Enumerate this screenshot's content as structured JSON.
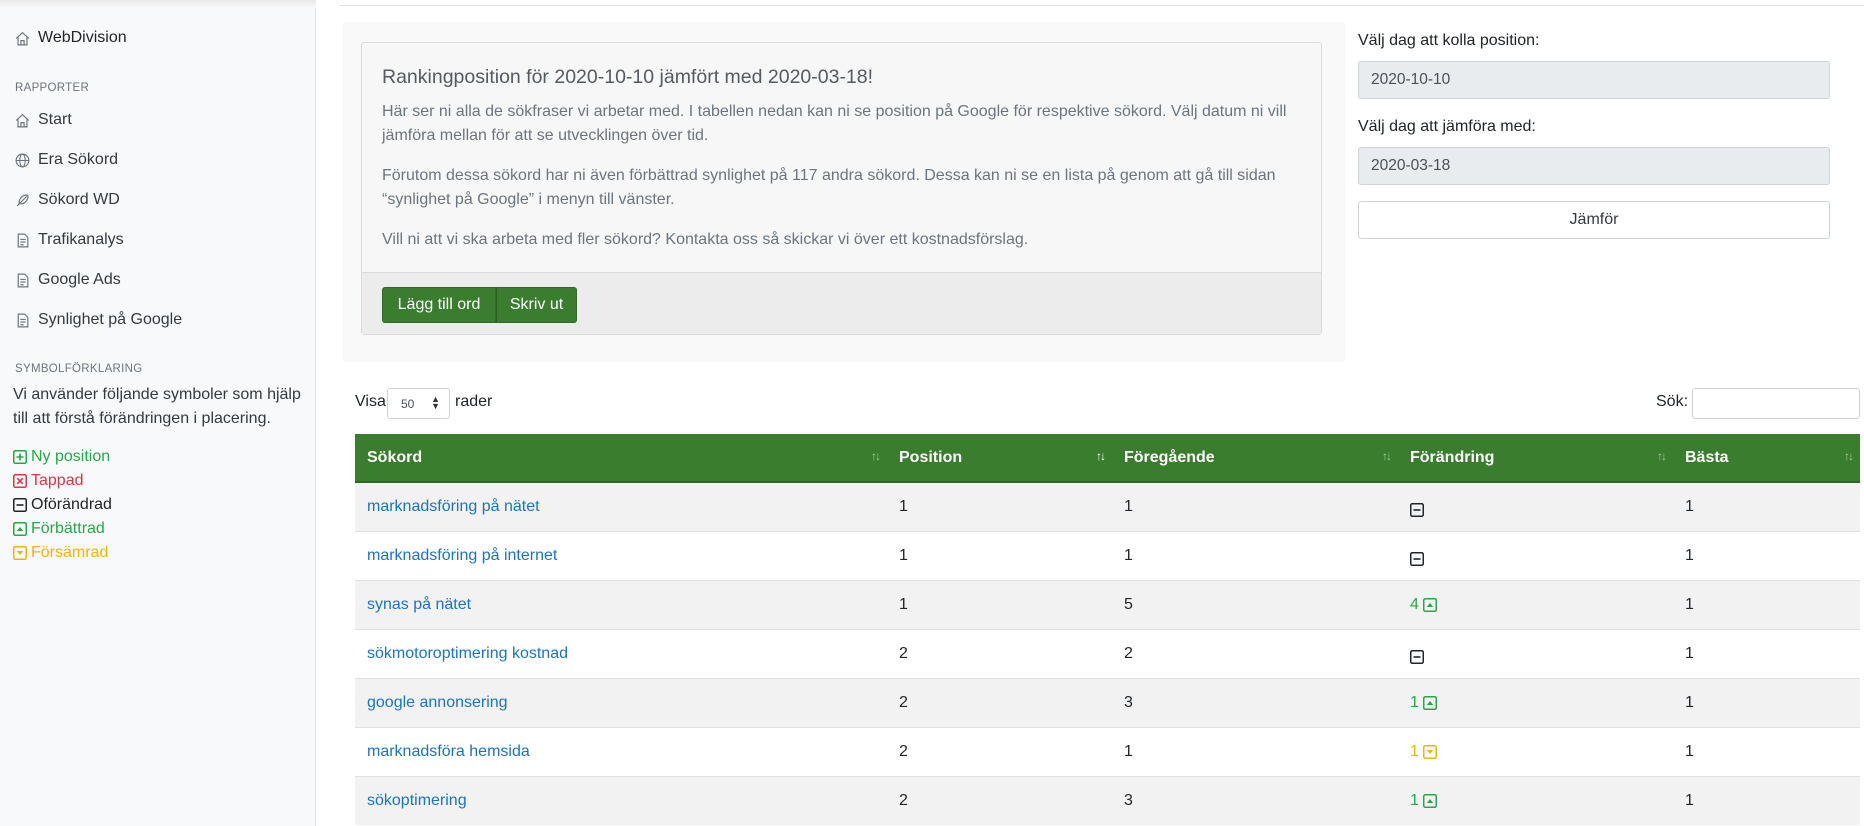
{
  "sidebar": {
    "brand": "WebDivision",
    "reports_heading": "RAPPORTER",
    "items": [
      {
        "label": "Start",
        "icon": "home-icon"
      },
      {
        "label": "Era Sökord",
        "icon": "globe-icon"
      },
      {
        "label": "Sökord WD",
        "icon": "feather-icon"
      },
      {
        "label": "Trafikanalys",
        "icon": "document-icon"
      },
      {
        "label": "Google Ads",
        "icon": "document-icon"
      },
      {
        "label": "Synlighet på Google",
        "icon": "document-icon"
      }
    ],
    "legend_heading": "SYMBOLFÖRKLARING",
    "legend_description": "Vi använder följande symboler som hjälp till att förstå förändringen i placering.",
    "legend": [
      {
        "label": "Ny position",
        "color": "#28a745",
        "icon": "plus-square-icon"
      },
      {
        "label": "Tappad",
        "color": "#dc3545",
        "icon": "x-square-icon"
      },
      {
        "label": "Oförändrad",
        "color": "#212529",
        "icon": "minus-square-icon"
      },
      {
        "label": "Förbättrad",
        "color": "#28a745",
        "icon": "caret-up-square-icon"
      },
      {
        "label": "Försämrad",
        "color": "#f3b307",
        "icon": "caret-down-square-icon"
      }
    ]
  },
  "info": {
    "title": "Rankingposition för 2020-10-10 jämfört med 2020-03-18!",
    "paragraphs": [
      "Här ser ni alla de sökfraser vi arbetar med. I tabellen nedan kan ni se position på Google för respektive sökord. Välj datum ni vill jämföra mellan för att se utvecklingen över tid.",
      "Förutom dessa sökord har ni även förbättrad synlighet på 117 andra sökord. Dessa kan ni se en lista på genom att gå till sidan “synlighet på Google” i menyn till vänster.",
      "Vill ni att vi ska arbeta med fler sökord? Kontakta oss så skickar vi över ett kostnadsförslag."
    ],
    "add_button": "Lägg till ord",
    "print_button": "Skriv ut"
  },
  "dates": {
    "position_label": "Välj dag att kolla position:",
    "position_value": "2020-10-10",
    "compare_label": "Välj dag att jämföra med:",
    "compare_value": "2020-03-18",
    "compare_button": "Jämför"
  },
  "table_controls": {
    "show_prefix": "Visa",
    "page_size": "50",
    "show_suffix": "rader",
    "search_label": "Sök:"
  },
  "table": {
    "columns": [
      "Sökord",
      "Position",
      "Föregående",
      "Förändring",
      "Bästa"
    ],
    "sorted_column": "Position",
    "rows": [
      {
        "keyword": "marknadsföring på nätet",
        "position": "1",
        "previous": "1",
        "change": "",
        "change_type": "unchanged",
        "best": "1"
      },
      {
        "keyword": "marknadsföring på internet",
        "position": "1",
        "previous": "1",
        "change": "",
        "change_type": "unchanged",
        "best": "1"
      },
      {
        "keyword": "synas på nätet",
        "position": "1",
        "previous": "5",
        "change": "4",
        "change_type": "improved",
        "best": "1"
      },
      {
        "keyword": "sökmotoroptimering kostnad",
        "position": "2",
        "previous": "2",
        "change": "",
        "change_type": "unchanged",
        "best": "1"
      },
      {
        "keyword": "google annonsering",
        "position": "2",
        "previous": "3",
        "change": "1",
        "change_type": "improved",
        "best": "1"
      },
      {
        "keyword": "marknadsföra hemsida",
        "position": "2",
        "previous": "1",
        "change": "1",
        "change_type": "worsened",
        "best": "1"
      },
      {
        "keyword": "sökoptimering",
        "position": "2",
        "previous": "3",
        "change": "1",
        "change_type": "improved",
        "best": "1"
      }
    ]
  }
}
